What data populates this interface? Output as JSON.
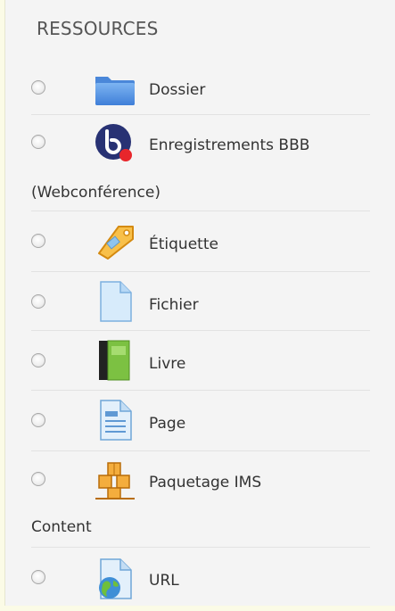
{
  "section": {
    "title": "RESSOURCES"
  },
  "items": [
    {
      "label": "Dossier",
      "icon": "folder-icon"
    },
    {
      "label": "Enregistrements BBB",
      "label_cont": "(Webconférence)",
      "icon": "bigbluebutton-icon"
    },
    {
      "label": "Étiquette",
      "icon": "tag-label-icon"
    },
    {
      "label": "Fichier",
      "icon": "file-icon"
    },
    {
      "label": "Livre",
      "icon": "book-icon"
    },
    {
      "label": "Page",
      "icon": "page-icon"
    },
    {
      "label": "Paquetage IMS",
      "label_cont": "Content",
      "icon": "ims-package-icon"
    },
    {
      "label": "URL",
      "icon": "url-globe-icon"
    }
  ],
  "colors": {
    "folder": "#5b9bea",
    "bbb_blue": "#283274",
    "bbb_red": "#e8262b",
    "tag_orange": "#f4a623",
    "book_green": "#7cc142",
    "ims_orange": "#f29a1f"
  }
}
